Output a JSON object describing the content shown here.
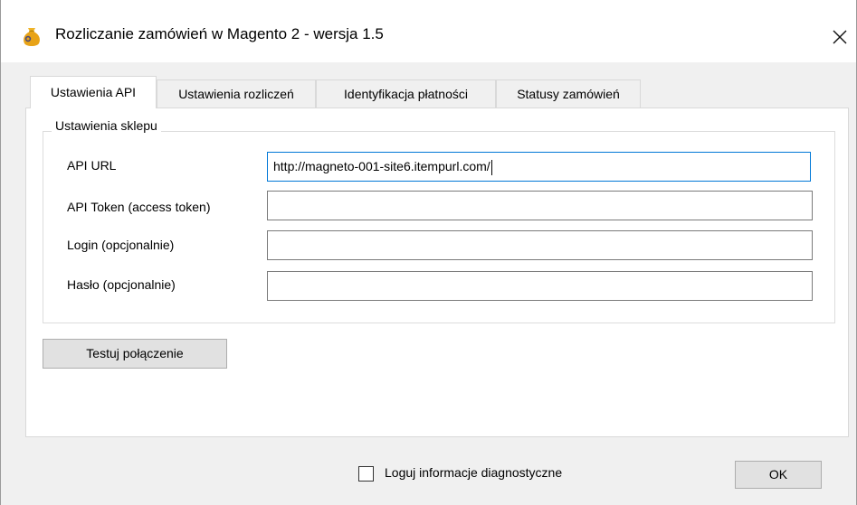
{
  "window": {
    "title": "Rozliczanie zamówień w Magento 2 - wersja 1.5",
    "icon": "money-bag-icon",
    "close_symbol": "✕"
  },
  "tabs": [
    {
      "label": "Ustawienia API",
      "active": true
    },
    {
      "label": "Ustawienia rozliczeń",
      "active": false
    },
    {
      "label": "Identyfikacja płatności",
      "active": false
    },
    {
      "label": "Statusy zamówień",
      "active": false
    }
  ],
  "shop_settings": {
    "group_title": "Ustawienia sklepu",
    "fields": [
      {
        "label": "API URL",
        "value": "http://magneto-001-site6.itempurl.com/"
      },
      {
        "label": "API Token (access token)",
        "value": ""
      },
      {
        "label": "Login (opcjonalnie)",
        "value": ""
      },
      {
        "label": "Hasło (opcjonalnie)",
        "value": ""
      }
    ]
  },
  "test_button": {
    "label": "Testuj połączenie"
  },
  "footer": {
    "diagnostic_checkbox": {
      "label": "Loguj informacje diagnostyczne",
      "checked": false
    },
    "ok_label": "OK"
  },
  "colors": {
    "focus_border": "#0078d7",
    "button_bg": "#e1e1e1",
    "icon_gold": "#e8a317"
  }
}
